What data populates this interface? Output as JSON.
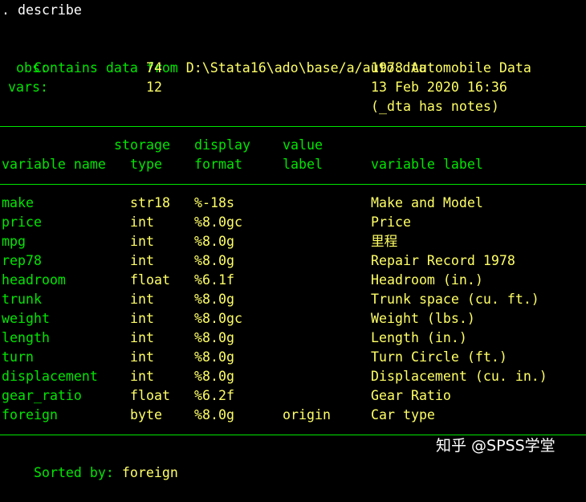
{
  "command": ". describe",
  "header": {
    "contains_label": "Contains data from",
    "path": "D:\\Stata16\\ado\\base/a/auto.dta",
    "obs_label": "obs:",
    "obs_value": "74",
    "vars_label": "vars:",
    "vars_value": "12",
    "dataset_label": "1978 Automobile Data",
    "datetime": "13 Feb 2020 16:36",
    "notes": "(_dta has notes)"
  },
  "columns": {
    "storage_top": "storage",
    "display_top": "display",
    "value_top": "value",
    "variable_name": "variable name",
    "type": "type",
    "format": "format",
    "label": "label",
    "variable_label": "variable label"
  },
  "rows": [
    {
      "name": "make",
      "type": "str18",
      "format": "%-18s",
      "vlabel": "",
      "label": "Make and Model"
    },
    {
      "name": "price",
      "type": "int",
      "format": "%8.0gc",
      "vlabel": "",
      "label": "Price"
    },
    {
      "name": "mpg",
      "type": "int",
      "format": "%8.0g",
      "vlabel": "",
      "label": "里程"
    },
    {
      "name": "rep78",
      "type": "int",
      "format": "%8.0g",
      "vlabel": "",
      "label": "Repair Record 1978"
    },
    {
      "name": "headroom",
      "type": "float",
      "format": "%6.1f",
      "vlabel": "",
      "label": "Headroom (in.)"
    },
    {
      "name": "trunk",
      "type": "int",
      "format": "%8.0g",
      "vlabel": "",
      "label": "Trunk space (cu. ft.)"
    },
    {
      "name": "weight",
      "type": "int",
      "format": "%8.0gc",
      "vlabel": "",
      "label": "Weight (lbs.)"
    },
    {
      "name": "length",
      "type": "int",
      "format": "%8.0g",
      "vlabel": "",
      "label": "Length (in.)"
    },
    {
      "name": "turn",
      "type": "int",
      "format": "%8.0g",
      "vlabel": "",
      "label": "Turn Circle (ft.)"
    },
    {
      "name": "displacement",
      "type": "int",
      "format": "%8.0g",
      "vlabel": "",
      "label": "Displacement (cu. in.)"
    },
    {
      "name": "gear_ratio",
      "type": "float",
      "format": "%6.2f",
      "vlabel": "",
      "label": "Gear Ratio"
    },
    {
      "name": "foreign",
      "type": "byte",
      "format": "%8.0g",
      "vlabel": "origin",
      "label": "Car type"
    }
  ],
  "footer": {
    "sorted_label": "Sorted by:",
    "sorted_value": "foreign"
  },
  "watermark": "知乎 @SPSS学堂",
  "colors": {
    "background": "#000000",
    "text": "#ffffff",
    "green": "#00e600",
    "yellow": "#ffff66"
  }
}
